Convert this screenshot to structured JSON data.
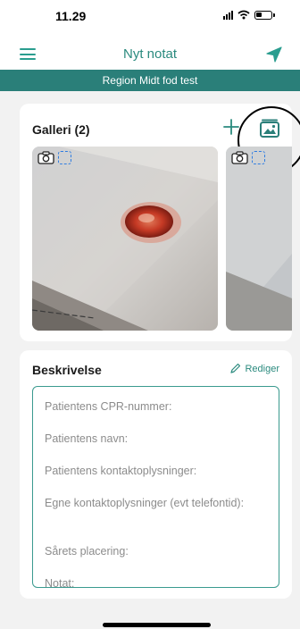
{
  "status_bar": {
    "time": "11.29"
  },
  "header": {
    "title": "Nyt notat"
  },
  "banner": {
    "text": "Region Midt fod test"
  },
  "gallery": {
    "title": "Galleri (2)",
    "photo_count": 2
  },
  "description": {
    "title": "Beskrivelse",
    "edit_label": "Rediger",
    "lines": [
      "Patientens CPR-nummer:",
      "Patientens navn:",
      "Patientens kontaktoplysninger:",
      "Egne kontaktoplysninger (evt telefontid):",
      "Sårets placering:",
      "Notat:"
    ]
  },
  "icons": {
    "menu": "hamburger-menu-icon",
    "send": "send-paper-plane-icon",
    "add": "plus-icon",
    "gallery": "photo-gallery-icon",
    "camera": "camera-icon",
    "select": "select-dashed-square-icon",
    "edit": "pencil-icon"
  },
  "colors": {
    "accent": "#2a8a7e",
    "banner": "#2a7f79",
    "select": "#2f7de1"
  }
}
